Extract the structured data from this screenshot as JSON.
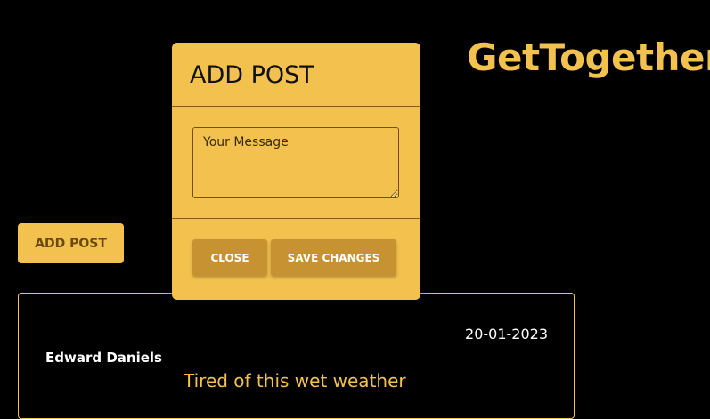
{
  "brand": {
    "title": "GetTogether"
  },
  "page": {
    "add_post_button": "ADD POST"
  },
  "post": {
    "date": "20-01-2023",
    "author": "Edward Daniels",
    "title": "Tired of this wet weather"
  },
  "modal": {
    "title": "ADD POST",
    "message_placeholder": "Your Message",
    "message_value": "",
    "close_label": "CLOSE",
    "save_label": "SAVE CHANGES"
  },
  "colors": {
    "background": "#000000",
    "accent": "#f2c14e",
    "button_dark": "#c79232"
  }
}
